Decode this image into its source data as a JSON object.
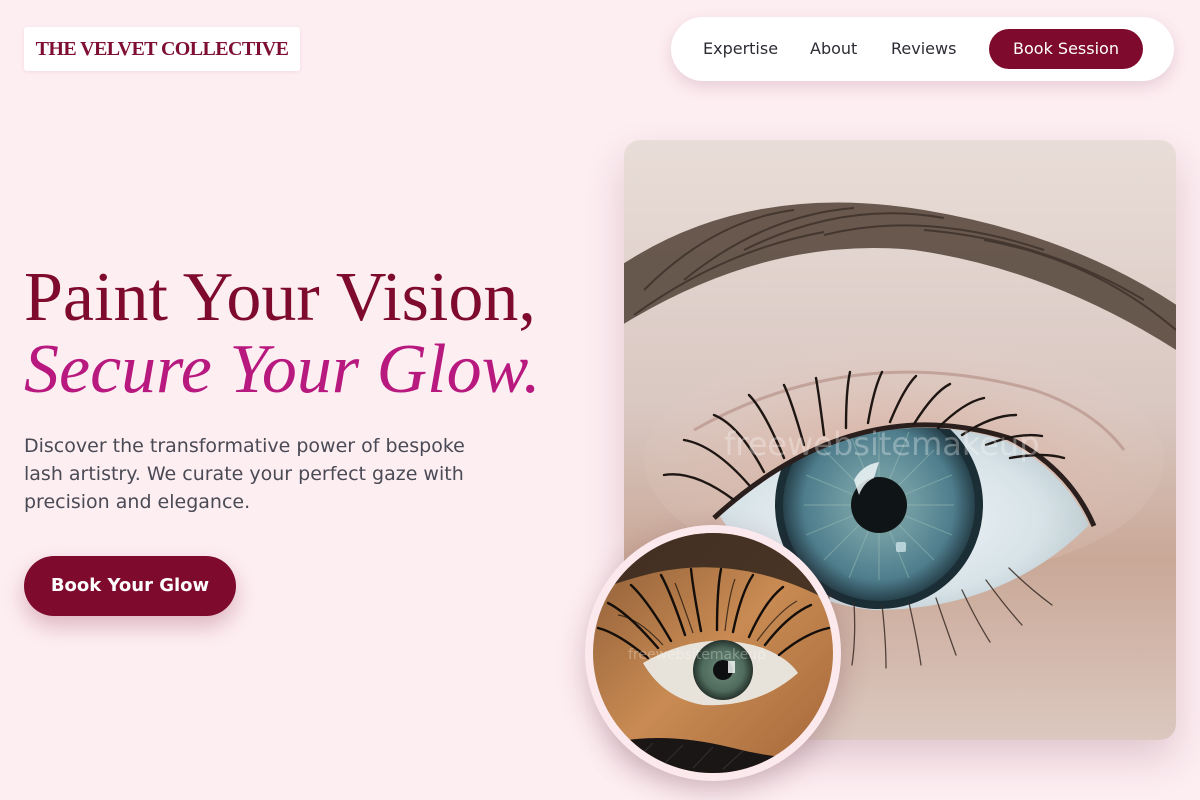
{
  "brand": {
    "name": "THE VELVET COLLECTIVE"
  },
  "nav": {
    "links": [
      "Expertise",
      "About",
      "Reviews"
    ],
    "cta": "Book Session"
  },
  "hero": {
    "title_line1": "Paint Your Vision,",
    "title_line2": "Secure Your Glow.",
    "description": "Discover the transformative power of bespoke lash artistry. We curate your perfect gaze with precision and elegance.",
    "cta": "Book Your Glow"
  },
  "images": {
    "main_alt": "Close-up of a blue-green eye with natural lashes",
    "inset_alt": "Close-up of an eye with lash extensions"
  },
  "colors": {
    "background": "#fdeef2",
    "brand_primary": "#7e0a2e",
    "accent_magenta": "#b8197e",
    "body_text": "#4a4a55"
  }
}
